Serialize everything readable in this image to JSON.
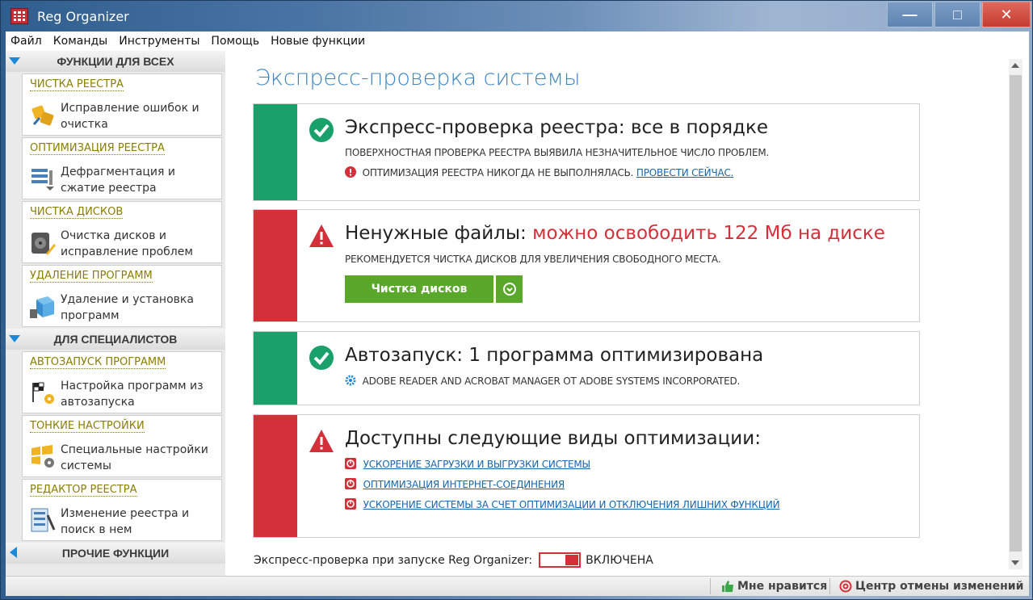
{
  "window": {
    "title": "Reg Organizer",
    "minimize_glyph": "—",
    "maximize_glyph": "□",
    "close_glyph": "✕"
  },
  "menu": [
    "Файл",
    "Команды",
    "Инструменты",
    "Помощь",
    "Новые функции"
  ],
  "sidebar": {
    "section_all": "ФУНКЦИИ ДЛЯ ВСЕХ",
    "section_pro": "ДЛЯ СПЕЦИАЛИСТОВ",
    "section_other": "ПРОЧИЕ ФУНКЦИИ",
    "cards": [
      {
        "title": "ЧИСТКА РЕЕСТРА",
        "desc": "Исправление ошибок и очистка",
        "icon": "registry-clean-icon"
      },
      {
        "title": "ОПТИМИЗАЦИЯ РЕЕСТРА",
        "desc": "Дефрагментация и сжатие реестра",
        "icon": "registry-optimize-icon"
      },
      {
        "title": "ЧИСТКА ДИСКОВ",
        "desc": "Очистка дисков и исправление проблем",
        "icon": "disk-clean-icon"
      },
      {
        "title": "УДАЛЕНИЕ ПРОГРАММ",
        "desc": "Удаление и установка программ",
        "icon": "uninstall-icon"
      },
      {
        "title": "АВТОЗАПУСК ПРОГРАММ",
        "desc": "Настройка программ из автозапуска",
        "icon": "autostart-icon"
      },
      {
        "title": "ТОНКИЕ НАСТРОЙКИ",
        "desc": "Специальные настройки системы",
        "icon": "tweaks-icon"
      },
      {
        "title": "РЕДАКТОР РЕЕСТРА",
        "desc": "Изменение реестра и поиск в нем",
        "icon": "registry-editor-icon"
      }
    ]
  },
  "main": {
    "title": "Экспресс-проверка системы",
    "panels": {
      "registry": {
        "title": "Экспресс-проверка реестра: все в порядке",
        "line1": "ПОВЕРХНОСТНАЯ ПРОВЕРКА РЕЕСТРА ВЫЯВИЛА НЕЗНАЧИТЕЛЬНОЕ ЧИСЛО ПРОБЛЕМ.",
        "line2": "ОПТИМИЗАЦИЯ РЕЕСТРА НИКОГДА НЕ ВЫПОЛНЯЛАСЬ.",
        "link": "ПРОВЕСТИ СЕЙЧАС."
      },
      "junk": {
        "title": "Ненужные файлы:",
        "highlight": "можно освободить 122 Мб на диске",
        "line1": "РЕКОМЕНДУЕТСЯ ЧИСТКА ДИСКОВ ДЛЯ УВЕЛИЧЕНИЯ СВОБОДНОГО МЕСТА.",
        "button": "Чистка дисков"
      },
      "autostart": {
        "title": "Автозапуск: 1 программа оптимизирована",
        "line1": "ADOBE READER AND ACROBAT MANAGER ОТ ADOBE SYSTEMS INCORPORATED."
      },
      "optimizations": {
        "title": "Доступны следующие виды оптимизации:",
        "links": [
          "УСКОРЕНИЕ ЗАГРУЗКИ И ВЫГРУЗКИ СИСТЕМЫ",
          "ОПТИМИЗАЦИЯ ИНТЕРНЕТ-СОЕДИНЕНИЯ",
          "УСКОРЕНИЕ СИСТЕМЫ ЗА СЧЕТ ОПТИМИЗАЦИИ И ОТКЛЮЧЕНИЯ ЛИШНИХ ФУНКЦИЙ"
        ]
      }
    },
    "startup_check_label": "Экспресс-проверка при запуске Reg Organizer:",
    "startup_check_state": "ВКЛЮЧЕНА"
  },
  "statusbar": {
    "like": "Мне нравится",
    "undo_center": "Центр отмены изменений"
  },
  "colors": {
    "ok": "#1aa06a",
    "warn": "#d4303a",
    "accent": "#3a84c2",
    "card_title": "#8a7e00",
    "button": "#5aa82a"
  }
}
